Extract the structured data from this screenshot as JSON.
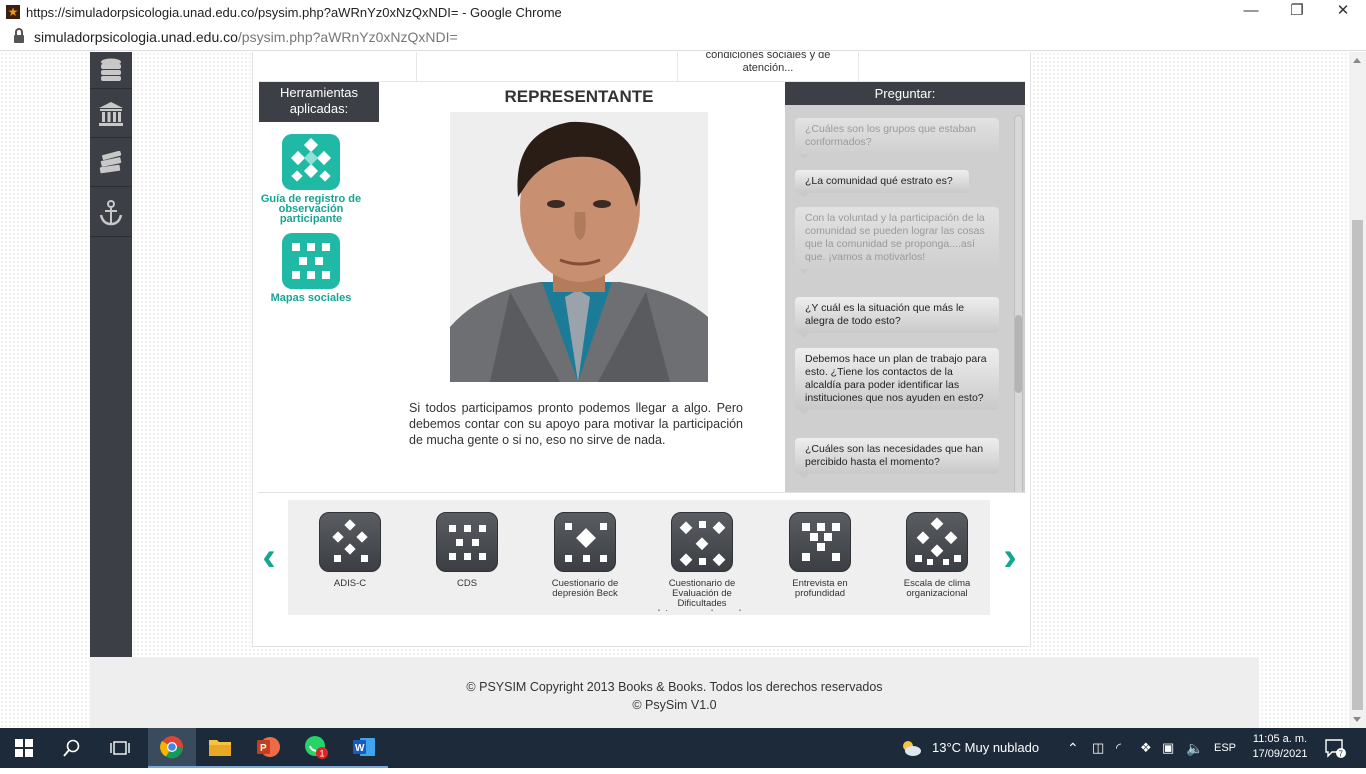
{
  "window": {
    "title": "https://simuladorpsicologia.unad.edu.co/psysim.php?aWRnYz0xNzQxNDI= - Google Chrome",
    "minimize": "—",
    "restore": "❐",
    "close": "✕"
  },
  "address": {
    "host": "simuladorpsicologia.unad.edu.co",
    "path": "/psysim.php?aWRnYz0xNzQxNDI="
  },
  "top_strip": {
    "text": "condiciones sociales y de atención..."
  },
  "tools": {
    "heading": "Herramientas aplicadas:",
    "items": [
      {
        "label": "Guía de registro de observación participante"
      },
      {
        "label": "Mapas sociales"
      }
    ]
  },
  "representative": {
    "title": "REPRESENTANTE",
    "reply": "Si todos participamos pronto podemos llegar a algo. Pero debemos contar con su apoyo para motivar la participación de mucha gente o si no, eso no sirve de nada."
  },
  "questions": {
    "heading": "Preguntar:",
    "items": [
      {
        "text": "¿Cuáles son los grupos que estaban conformados?",
        "faded": true
      },
      {
        "text": "¿La comunidad qué estrato es?",
        "faded": false
      },
      {
        "text": "Con la voluntad y la participación de la comunidad se pueden lograr las cosas que la comunidad se proponga....así que. ¡vamos a motivarlos!",
        "faded": true
      },
      {
        "text": "¿Y cuál es la situación que más le alegra de todo esto?",
        "faded": false
      },
      {
        "text": "Debemos hace un plan de trabajo para esto. ¿Tiene los contactos de la alcaldía para poder identificar las instituciones que nos ayuden en esto?",
        "faded": false
      },
      {
        "text": "¿Cuáles son las necesidades que han percibido hasta el momento?",
        "faded": false
      }
    ]
  },
  "carousel": {
    "prev": "‹",
    "next": "›",
    "items": [
      {
        "label": "ADIS-C"
      },
      {
        "label": "CDS"
      },
      {
        "label": "Cuestionario de depresión Beck"
      },
      {
        "label": "Cuestionario de Evaluación de Dificultades Interpersonales en la"
      },
      {
        "label": "Entrevista en profundidad"
      },
      {
        "label": "Escala de clima organizacional"
      }
    ]
  },
  "footer": {
    "line1": "© PSYSIM Copyright 2013 Books & Books. Todos los derechos reservados",
    "line2": "© PsySim V1.0"
  },
  "taskbar": {
    "weather": "13°C  Muy nublado",
    "lang": "ESP",
    "time": "11:05 a. m.",
    "date": "17/09/2021",
    "whatsapp_badge": "1",
    "notif_count": "7"
  }
}
